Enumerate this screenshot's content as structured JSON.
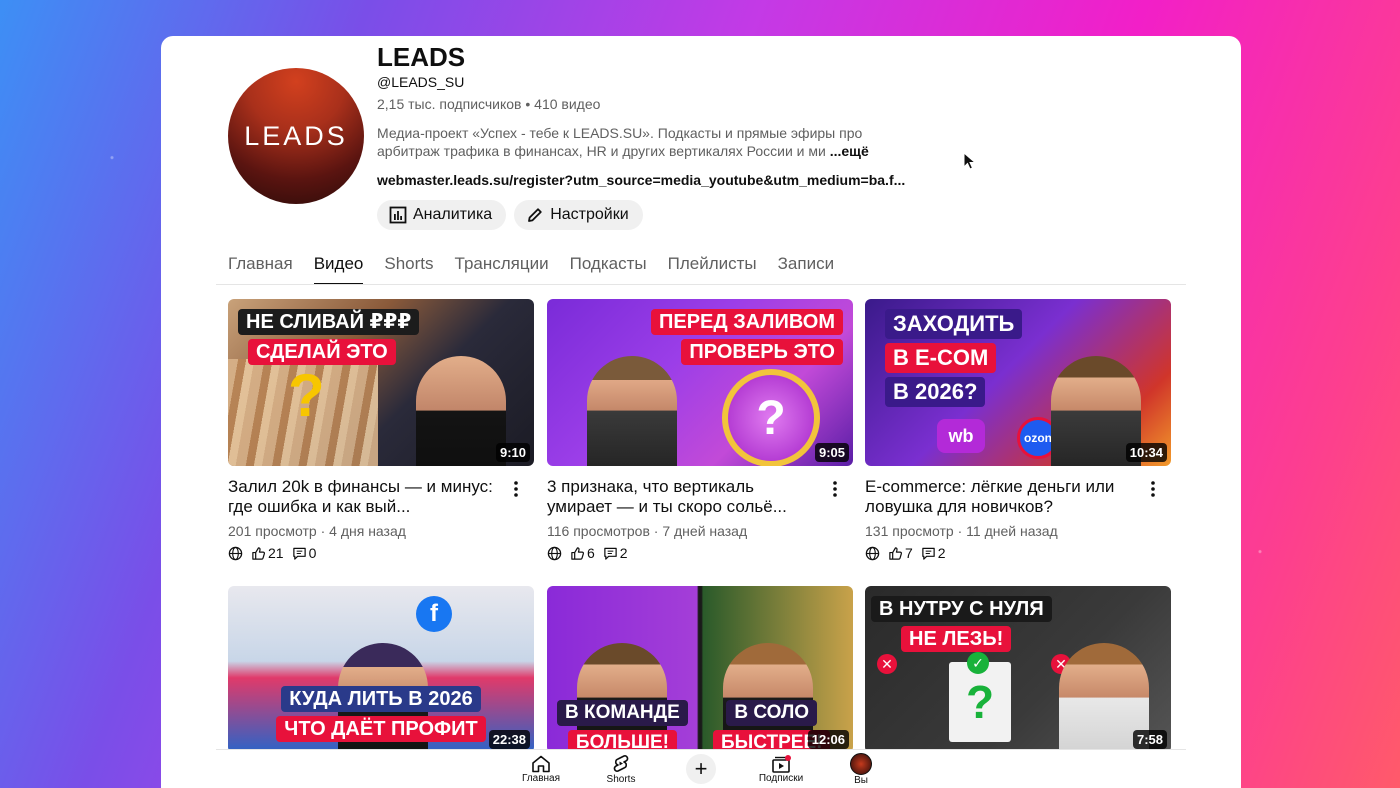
{
  "channel": {
    "avatar_text": "LEADS",
    "name": "LEADS",
    "handle": "@LEADS_SU",
    "stats": "2,15 тыс. подписчиков • 410 видео",
    "description": "Медиа-проект «Успех - тебе к LEADS.SU». Подкасты и прямые эфиры про арбитраж трафика в финансах, HR и других вертикалях России и ми",
    "more_label": "...ещё",
    "link": "webmaster.leads.su/register?utm_source=media_youtube&utm_medium=ba.f...",
    "analytics_label": "Аналитика",
    "settings_label": "Настройки"
  },
  "tabs": [
    {
      "label": "Главная"
    },
    {
      "label": "Видео"
    },
    {
      "label": "Shorts"
    },
    {
      "label": "Трансляции"
    },
    {
      "label": "Подкасты"
    },
    {
      "label": "Плейлисты"
    },
    {
      "label": "Записи"
    }
  ],
  "videos": [
    {
      "thumb_lines": [
        "НЕ СЛИВАЙ ₽₽₽",
        "СДЕЛАЙ ЭТО"
      ],
      "duration": "9:10",
      "title": "Залил 20k в финансы — и минус: где ошибка и как вый...",
      "meta": "201 просмотр · 4 дня назад",
      "likes": "21",
      "comments": "0"
    },
    {
      "thumb_lines": [
        "ПЕРЕД ЗАЛИВОМ",
        "ПРОВЕРЬ ЭТО"
      ],
      "duration": "9:05",
      "title": "3 признака, что вертикаль умирает — и ты скоро сольё...",
      "meta": "116 просмотров · 7 дней назад",
      "likes": "6",
      "comments": "2"
    },
    {
      "thumb_lines": [
        "ЗАХОДИТЬ",
        "В E-COM",
        "В 2026?"
      ],
      "duration": "10:34",
      "title": "E-commerce: лёгкие деньги или ловушка для новичков?",
      "meta": "131 просмотр · 11 дней назад",
      "likes": "7",
      "comments": "2"
    },
    {
      "thumb_lines": [
        "КУДА ЛИТЬ В 2026",
        "ЧТО ДАЁТ ПРОФИТ"
      ],
      "duration": "22:38"
    },
    {
      "thumb_lines": [
        "В КОМАНДЕ",
        "БОЛЬШЕ!",
        "В СОЛО",
        "БЫСТРЕЕ!"
      ],
      "duration": "12:06"
    },
    {
      "thumb_lines": [
        "В НУТРУ С НУЛЯ",
        "НЕ ЛЕЗЬ!"
      ],
      "duration": "7:58"
    }
  ],
  "bottom_nav": {
    "home": "Главная",
    "shorts": "Shorts",
    "create": "+",
    "subscriptions": "Подписки",
    "you": "Вы"
  },
  "colors": {
    "accent_red": "#e8113b",
    "brand_dark": "#2a0b09",
    "text_secondary": "#606060"
  }
}
